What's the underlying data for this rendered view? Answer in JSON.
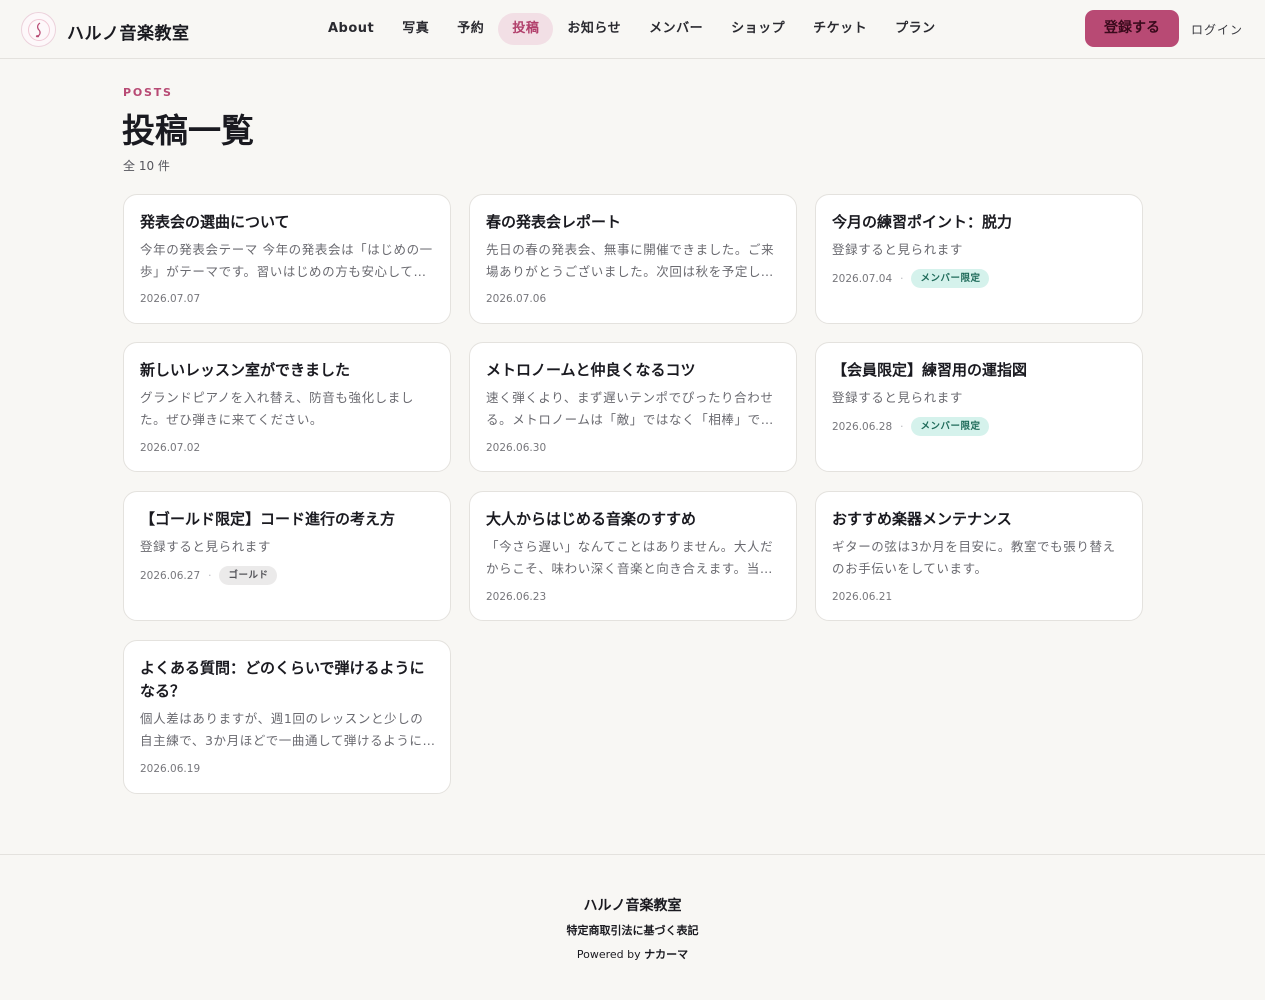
{
  "header": {
    "brand": "ハルノ音楽教室",
    "nav": [
      {
        "label": "About",
        "active": false
      },
      {
        "label": "写真",
        "active": false
      },
      {
        "label": "予約",
        "active": false
      },
      {
        "label": "投稿",
        "active": true
      },
      {
        "label": "お知らせ",
        "active": false
      },
      {
        "label": "メンバー",
        "active": false
      },
      {
        "label": "ショップ",
        "active": false
      },
      {
        "label": "チケット",
        "active": false
      },
      {
        "label": "プラン",
        "active": false
      }
    ],
    "register_label": "登録する",
    "login_label": "ログイン"
  },
  "page": {
    "eyebrow": "POSTS",
    "title": "投稿一覧",
    "count": "全 10 件"
  },
  "posts": [
    {
      "title": "発表会の選曲について",
      "excerpt": "今年の発表会テーマ 今年の発表会は「はじめの一歩」がテーマです。習いはじめの方も安心して参加できる曲を選びました。",
      "date": "2026.07.07",
      "badge": ""
    },
    {
      "title": "春の発表会レポート",
      "excerpt": "先日の春の発表会、無事に開催できました。ご来場ありがとうございました。次回は秋を予定しています。",
      "date": "2026.07.06",
      "badge": ""
    },
    {
      "title": "今月の練習ポイント：脱力",
      "excerpt": "登録すると見られます",
      "date": "2026.07.04",
      "badge": "メンバー限定",
      "badge_type": "member"
    },
    {
      "title": "新しいレッスン室ができました",
      "excerpt": "グランドピアノを入れ替え、防音も強化しました。ぜひ弾きに来てください。",
      "date": "2026.07.02",
      "badge": ""
    },
    {
      "title": "メトロノームと仲良くなるコツ",
      "excerpt": "速く弾くより、まず遅いテンポでぴったり合わせる。メトロノームは「敵」ではなく「相棒」です。",
      "date": "2026.06.30",
      "badge": ""
    },
    {
      "title": "【会員限定】練習用の運指図",
      "excerpt": "登録すると見られます",
      "date": "2026.06.28",
      "badge": "メンバー限定",
      "badge_type": "member"
    },
    {
      "title": "【ゴールド限定】コード進行の考え方",
      "excerpt": "登録すると見られます",
      "date": "2026.06.27",
      "badge": "ゴールド",
      "badge_type": "gold"
    },
    {
      "title": "大人からはじめる音楽のすすめ",
      "excerpt": "「今さら遅い」なんてことはありません。大人だからこそ、味わい深く音楽と向き合えます。当教室でも多くの方が始めています。",
      "date": "2026.06.23",
      "badge": ""
    },
    {
      "title": "おすすめ楽器メンテナンス",
      "excerpt": "ギターの弦は3か月を目安に。教室でも張り替えのお手伝いをしています。",
      "date": "2026.06.21",
      "badge": ""
    },
    {
      "title": "よくある質問：どのくらいで弾けるようになる？",
      "excerpt": "個人差はありますが、週1回のレッスンと少しの自主練で、3か月ほどで一曲通して弾けるようになります。",
      "date": "2026.06.19",
      "badge": ""
    }
  ],
  "footer": {
    "brand": "ハルノ音楽教室",
    "legal": "特定商取引法に基づく表記",
    "powered_prefix": "Powered by",
    "powered_name": "ナカーマ"
  },
  "colors": {
    "accent": "#b84a74",
    "background": "#f8f7f4",
    "member_badge": "#d5f2ec",
    "gold_badge": "#ebeaea"
  }
}
